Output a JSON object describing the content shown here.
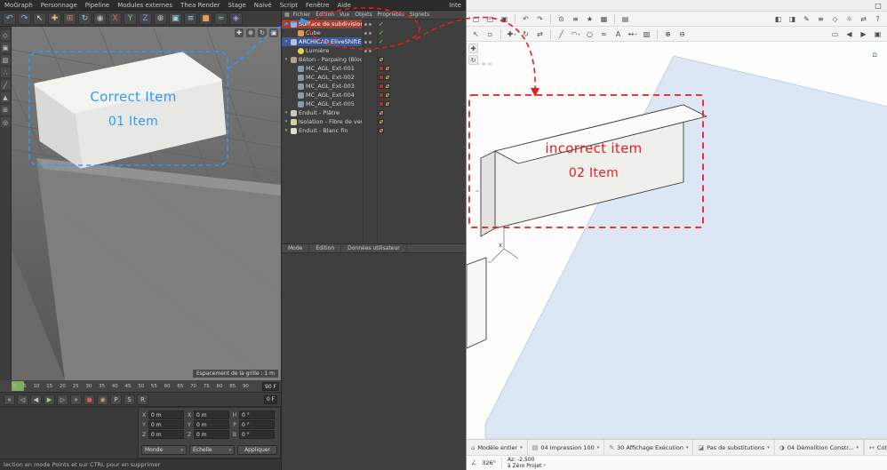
{
  "colors": {
    "blue_annotation": "#2e9bff",
    "red_annotation": "#e81c24",
    "c4d_selection_red": "#a04034",
    "c4d_selection_blue": "#3c5a95",
    "archicad_floor_blue": "#dce6f4"
  },
  "annotations": {
    "correct": {
      "line1": "Correct Item",
      "line2": "01 Item"
    },
    "incorrect": {
      "line1": "incorrect item",
      "line2": "02 Item"
    }
  },
  "c4d": {
    "menubar": {
      "items": [
        "MoGraph",
        "Personnage",
        "Pipeline",
        "Modules externes",
        "Thea Render",
        "Stage",
        "Naivé",
        "Script",
        "Fenêtre",
        "Aide"
      ],
      "layout_label": "Inte"
    },
    "toolbar_icons": [
      {
        "name": "undo-icon",
        "glyph": "↶",
        "color": "#86b7e8"
      },
      {
        "name": "redo-icon",
        "glyph": "↷",
        "color": "#86b7e8"
      },
      {
        "name": "select-tool-icon",
        "glyph": "↖",
        "color": "#e8e0c8"
      },
      {
        "name": "move-tool-icon",
        "glyph": "✚",
        "color": "#d8c878"
      },
      {
        "name": "scale-tool-icon",
        "glyph": "⊞",
        "color": "#c87878"
      },
      {
        "name": "rotate-tool-icon",
        "glyph": "↻",
        "color": "#88c0e8"
      },
      {
        "name": "last-tool-icon",
        "glyph": "◉",
        "color": "#b8b8b8"
      },
      {
        "name": "axis-x-lock-icon",
        "glyph": "X",
        "color": "#e06666"
      },
      {
        "name": "axis-y-lock-icon",
        "glyph": "Y",
        "color": "#7ec86a"
      },
      {
        "name": "axis-z-lock-icon",
        "glyph": "Z",
        "color": "#6a9ee8"
      },
      {
        "name": "coord-system-icon",
        "glyph": "⊕",
        "color": "#c8c8c8"
      },
      {
        "name": "render-view-icon",
        "glyph": "▣",
        "color": "#9ad0f0"
      },
      {
        "name": "render-settings-icon",
        "glyph": "≡",
        "color": "#9ad0f0"
      },
      {
        "name": "cube-primitive-icon",
        "glyph": "■",
        "color": "#e8a050"
      },
      {
        "name": "spline-icon",
        "glyph": "≈",
        "color": "#88d0a0"
      },
      {
        "name": "mograph-icon",
        "glyph": "◈",
        "color": "#b090e0"
      }
    ],
    "sidebar_icons": [
      {
        "name": "make-editable-icon",
        "glyph": "◇"
      },
      {
        "name": "model-mode-icon",
        "glyph": "▣"
      },
      {
        "name": "texture-mode-icon",
        "glyph": "▨"
      },
      {
        "name": "points-mode-icon",
        "glyph": "∴"
      },
      {
        "name": "edges-mode-icon",
        "glyph": "╱"
      },
      {
        "name": "polygons-mode-icon",
        "glyph": "▲"
      },
      {
        "name": "workplane-icon",
        "glyph": "⊞"
      },
      {
        "name": "snap-icon",
        "glyph": "◎"
      }
    ],
    "viewport": {
      "controls": [
        {
          "name": "pan-view-icon",
          "glyph": "✚"
        },
        {
          "name": "zoom-view-icon",
          "glyph": "⊕"
        },
        {
          "name": "rotate-view-icon",
          "glyph": "↻"
        },
        {
          "name": "maximize-view-icon",
          "glyph": "▣"
        }
      ],
      "grid_label": "Espacement de la grille : 1 m"
    },
    "timeline": {
      "ticks": [
        "0",
        "5",
        "10",
        "15",
        "20",
        "25",
        "30",
        "35",
        "40",
        "45",
        "50",
        "55",
        "60",
        "65",
        "70",
        "75",
        "80",
        "85",
        "90"
      ],
      "end_frame": "90 F",
      "current_frame": "0 F"
    },
    "transport_icons": [
      {
        "name": "goto-start-button",
        "glyph": "«"
      },
      {
        "name": "prev-key-button",
        "glyph": "◁"
      },
      {
        "name": "prev-frame-button",
        "glyph": "◀"
      },
      {
        "name": "play-button",
        "glyph": "▶",
        "color": "#a6d28f"
      },
      {
        "name": "next-frame-button",
        "glyph": "▷"
      },
      {
        "name": "goto-end-button",
        "glyph": "»"
      },
      {
        "name": "record-button",
        "glyph": "●",
        "color": "#e05a50"
      },
      {
        "name": "autokey-button",
        "glyph": "◉",
        "color": "#e0a050"
      },
      {
        "name": "key-position-button",
        "glyph": "P"
      },
      {
        "name": "key-scale-button",
        "glyph": "S"
      },
      {
        "name": "key-rotation-button",
        "glyph": "R"
      }
    ],
    "coords": {
      "groups": [
        {
          "name": "position",
          "rows": [
            [
              "X",
              "0 m"
            ],
            [
              "Y",
              "0 m"
            ],
            [
              "Z",
              "0 m"
            ]
          ]
        },
        {
          "name": "size",
          "rows": [
            [
              "X",
              "0 m"
            ],
            [
              "Y",
              "0 m"
            ],
            [
              "Z",
              "0 m"
            ]
          ]
        },
        {
          "name": "rotation",
          "rows": [
            [
              "H",
              "0 °"
            ],
            [
              "P",
              "0 °"
            ],
            [
              "B",
              "0 °"
            ]
          ]
        }
      ],
      "world_select": "Monde",
      "scale_select": "Échelle",
      "apply_button": "Appliquer"
    },
    "statusbar": "lection en mode Points et sur CTRL pour en supprimer"
  },
  "object_manager": {
    "menu": [
      "Fichier",
      "Édition",
      "Vue",
      "Objets",
      "Propriétés",
      "Signets"
    ],
    "items": [
      {
        "label": "Surface de subdivision",
        "indent": 0,
        "icon": "subdivision-icon",
        "icon_color": "#8fb4e0",
        "selected": "red",
        "expand": true,
        "dots": true,
        "check": true
      },
      {
        "label": "Cube",
        "indent": 1,
        "icon": "cube-icon",
        "icon_color": "#e09a46",
        "dots": true,
        "check": true
      },
      {
        "label": "ARCHICAD EliveShiftEnt",
        "indent": 0,
        "icon": "archicad-icon",
        "icon_color": "#b8c4d4",
        "selected": "blue",
        "expand": true,
        "dots": true,
        "check": true
      },
      {
        "label": "Lumière",
        "indent": 1,
        "icon": "light-icon",
        "icon_color": "#e8d24a",
        "dots": true
      },
      {
        "label": "Béton - Parpaing (Blocs)",
        "indent": 0,
        "icon": "material-icon",
        "icon_color": "#b0a494",
        "expand": true,
        "tex": true
      },
      {
        "label": "MC_AGL_Ext-001",
        "indent": 1,
        "icon": "tag-icon",
        "icon_color": "#8a9aae",
        "swatch": "#b03428",
        "tex": true
      },
      {
        "label": "MC_AGL_Ext-002",
        "indent": 1,
        "icon": "tag-icon",
        "icon_color": "#8a9aae",
        "swatch": "#b03428",
        "tex": true
      },
      {
        "label": "MC_AGL_Ext-003",
        "indent": 1,
        "icon": "tag-icon",
        "icon_color": "#8a9aae",
        "swatch": "#b03428",
        "tex": true
      },
      {
        "label": "MC_AGL_Ext-004",
        "indent": 1,
        "icon": "tag-icon",
        "icon_color": "#8a9aae",
        "swatch": "#b03428",
        "tex": true
      },
      {
        "label": "MC_AGL_Ext-005",
        "indent": 1,
        "icon": "tag-icon",
        "icon_color": "#8a9aae",
        "swatch": "#b03428",
        "tex": true
      },
      {
        "label": "Enduit - Plâtre",
        "indent": 0,
        "icon": "material-icon",
        "icon_color": "#cfc8be",
        "expand": true,
        "tex": true
      },
      {
        "label": "Isolation - Fibre de verre",
        "indent": 0,
        "icon": "material-icon",
        "icon_color": "#d8cf9a",
        "expand": true,
        "tex": true
      },
      {
        "label": "Enduit - Blanc fin",
        "indent": 0,
        "icon": "material-icon",
        "icon_color": "#e2ddd4",
        "expand": true,
        "tex": true
      }
    ],
    "tabs": [
      "Mode",
      "Édition",
      "Données utilisateur"
    ]
  },
  "archicad": {
    "window_controls": [
      {
        "name": "minimize-button",
        "glyph": "—"
      },
      {
        "name": "maximize-button",
        "glyph": "□"
      },
      {
        "name": "close-button",
        "glyph": "×"
      }
    ],
    "toolbar1_left": [
      {
        "name": "new-project-icon",
        "glyph": "▢"
      },
      {
        "name": "open-icon",
        "glyph": "◰"
      },
      {
        "name": "save-icon",
        "glyph": "▣"
      },
      "|",
      {
        "name": "undo-icon",
        "glyph": "↶"
      },
      {
        "name": "redo-icon",
        "glyph": "↷"
      },
      "|",
      {
        "name": "find-select-icon",
        "glyph": "⊙"
      },
      {
        "name": "element-settings-icon",
        "glyph": "≡"
      },
      {
        "name": "favorites-icon",
        "glyph": "★"
      },
      {
        "name": "layers-icon",
        "glyph": "▦"
      },
      "|",
      {
        "name": "print-icon",
        "glyph": "▤"
      }
    ],
    "toolbar1_right": [
      {
        "name": "navigator-icon",
        "glyph": "◧"
      },
      {
        "name": "organizer-icon",
        "glyph": "◨"
      },
      {
        "name": "pen-sets-icon",
        "glyph": "✎"
      },
      {
        "name": "quick-options-icon",
        "glyph": "≡"
      },
      {
        "name": "3d-style-icon",
        "glyph": "◇"
      },
      {
        "name": "sun-study-icon",
        "glyph": "☼"
      },
      {
        "name": "teamwork-icon",
        "glyph": "⇄"
      },
      {
        "name": "help-icon",
        "glyph": "?"
      }
    ],
    "toolbar2_left": [
      {
        "name": "arrow-tool-icon",
        "glyph": "↖"
      },
      {
        "name": "marquee-tool-icon",
        "glyph": "▫"
      },
      "|",
      {
        "name": "move-icon",
        "glyph": "✚",
        "caret": true
      },
      {
        "name": "rotate-icon",
        "glyph": "↻"
      },
      {
        "name": "mirror-icon",
        "glyph": "⇄"
      },
      "|",
      {
        "name": "line-tool-icon",
        "glyph": "╱"
      },
      {
        "name": "arc-tool-icon",
        "glyph": "◠",
        "caret": true
      },
      {
        "name": "circle-tool-icon",
        "glyph": "○"
      },
      {
        "name": "spline-tool-icon",
        "glyph": "≈"
      },
      {
        "name": "text-tool-icon",
        "glyph": "A"
      },
      {
        "name": "dimension-tool-icon",
        "glyph": "↔",
        "caret": true
      },
      {
        "name": "hatch-tool-icon",
        "glyph": "▨"
      },
      "|",
      {
        "name": "zoom-in-icon",
        "glyph": "⊕"
      },
      {
        "name": "zoom-out-icon",
        "glyph": "⊖"
      }
    ],
    "toolbar2_right": [
      {
        "name": "fit-in-window-icon",
        "glyph": "▭"
      },
      {
        "name": "previous-view-icon",
        "glyph": "◀"
      },
      {
        "name": "next-view-icon",
        "glyph": "▶"
      },
      {
        "name": "fullscreen-icon",
        "glyph": "▣"
      }
    ],
    "canvas_icons": [
      {
        "name": "pan-view-icon",
        "glyph": "✚"
      },
      {
        "name": "orbit-view-icon",
        "glyph": "↻"
      }
    ],
    "home_icon": {
      "name": "home-view-icon",
      "glyph": "⌂"
    },
    "quickbar": [
      {
        "name": "model-filter",
        "icon": "⌂",
        "label": "Modèle entier",
        "caret": true
      },
      {
        "name": "layer-combination",
        "icon": "▤",
        "label": "04 Impression 100",
        "caret": true
      },
      {
        "name": "pen-set",
        "icon": "✎",
        "label": "30 Affichage Exécution",
        "caret": true
      },
      {
        "name": "graphic-override",
        "icon": "◪",
        "label": "Pas de substitutions",
        "caret": true
      },
      {
        "name": "renovation-filter",
        "icon": "◑",
        "label": "04 Démolition Constr...",
        "caret": true
      },
      {
        "name": "dimensions-unit",
        "icon": "↔",
        "label": "Cotations cm",
        "caret": false
      }
    ],
    "tracker": {
      "angle": "326°",
      "elevation": "Az: -2,500",
      "reference": "à Zéro Projet"
    },
    "axis_x_label": "x"
  }
}
